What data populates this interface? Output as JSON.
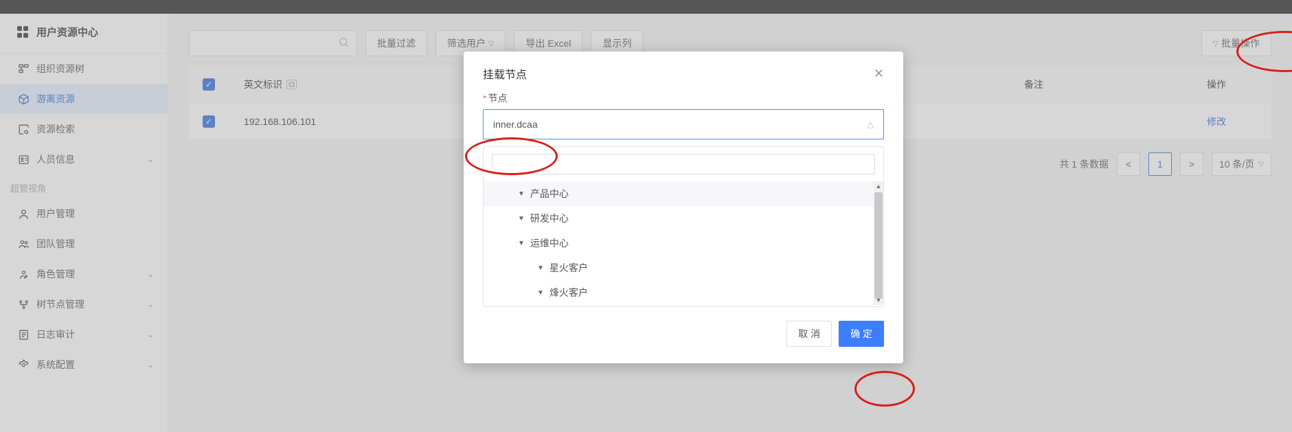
{
  "app_title": "用户资源中心",
  "sidebar": {
    "items": [
      {
        "label": "组织资源树",
        "expandable": false
      },
      {
        "label": "游离资源",
        "expandable": false,
        "active": true
      },
      {
        "label": "资源检索",
        "expandable": false
      },
      {
        "label": "人员信息",
        "expandable": true
      }
    ],
    "section_label": "超管视角",
    "admin_items": [
      {
        "label": "用户管理",
        "expandable": false
      },
      {
        "label": "团队管理",
        "expandable": false
      },
      {
        "label": "角色管理",
        "expandable": true
      },
      {
        "label": "树节点管理",
        "expandable": true
      },
      {
        "label": "日志审计",
        "expandable": true
      },
      {
        "label": "系统配置",
        "expandable": true
      }
    ]
  },
  "toolbar": {
    "search_placeholder": "",
    "batch_filter": "批量过滤",
    "filter_label": "筛选用户",
    "export_excel": "导出 Excel",
    "show_columns": "显示列",
    "batch_action": "批量操作"
  },
  "table": {
    "headers": {
      "id": "英文标识",
      "note": "备注",
      "op": "操作"
    },
    "rows": [
      {
        "id": "192.168.106.101",
        "op": "修改"
      }
    ]
  },
  "pagination": {
    "total_text": "共 1 条数据",
    "current": "1",
    "page_size": "10 条/页"
  },
  "modal": {
    "title": "挂载节点",
    "field_label": "节点",
    "select_value": "inner.dcaa",
    "cancel": "取 消",
    "ok": "确 定",
    "tree": [
      {
        "label": "产品中心",
        "level": 1,
        "highlight": true
      },
      {
        "label": "研发中心",
        "level": 1
      },
      {
        "label": "运维中心",
        "level": 1
      },
      {
        "label": "星火客户",
        "level": 2
      },
      {
        "label": "烽火客户",
        "level": 2
      }
    ]
  }
}
